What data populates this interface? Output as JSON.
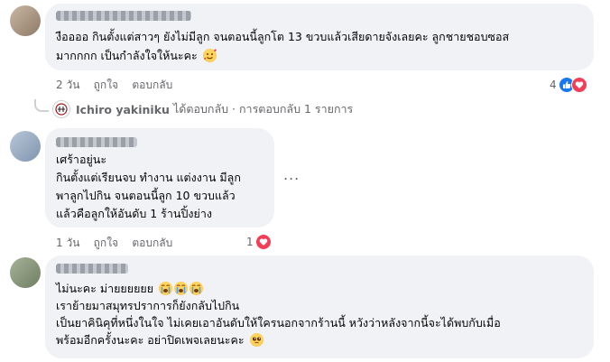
{
  "comments": [
    {
      "lines": [
        "งืออออ กินตั้งแต่สาวๆ ยังไม่มีลูก จนตอนนี้ลูกโต 13 ขวบแล้วเสียดายจังเลยคะ ลูกชายชอบซอส",
        "มากกกก เป็นกำลังใจให้นะคะ"
      ],
      "emoji": "smiling-face-with-hearts",
      "time": "2 วัน",
      "like": "ถูกใจ",
      "reply": "ตอบกลับ",
      "reaction_count": "4",
      "reactions": [
        "like",
        "love"
      ]
    },
    {
      "lines": [
        "เศร้าอยู่นะ",
        "กินตั้งแต่เรียนจบ ทำงาน แต่งงาน มีลูก",
        "พาลูกไปกิน จนตอนนี้ลูก 10 ขวบแล้ว",
        "แล้วคือลูกให้อันดับ 1 ร้านปิ้งย่าง"
      ],
      "more": "...",
      "time": "1 วัน",
      "like": "ถูกใจ",
      "reply": "ตอบกลับ",
      "reaction_count": "1",
      "reactions": [
        "love"
      ]
    },
    {
      "lines": [
        "ไม่นะคะ ม่ายยยยยย",
        "เราย้ายมาสมุทรปราการก็ยังกลับไปกิน",
        "เป็นยาคินิคุที่หนึ่งในใจ ไม่เคยเอาอันดับให้ใครนอกจากร้านนี้ หวังว่าหลังจากนี้จะได้พบกับเมื่อ",
        "พร้อมอีกครั้งนะคะ อย่าปิดเพจเลยนะคะ"
      ],
      "emoji": "pleading-face"
    }
  ],
  "reply_line": {
    "name": "Ichiro yakiniku",
    "text": "ได้ตอบกลับ · การตอบกลับ 1 รายการ"
  }
}
